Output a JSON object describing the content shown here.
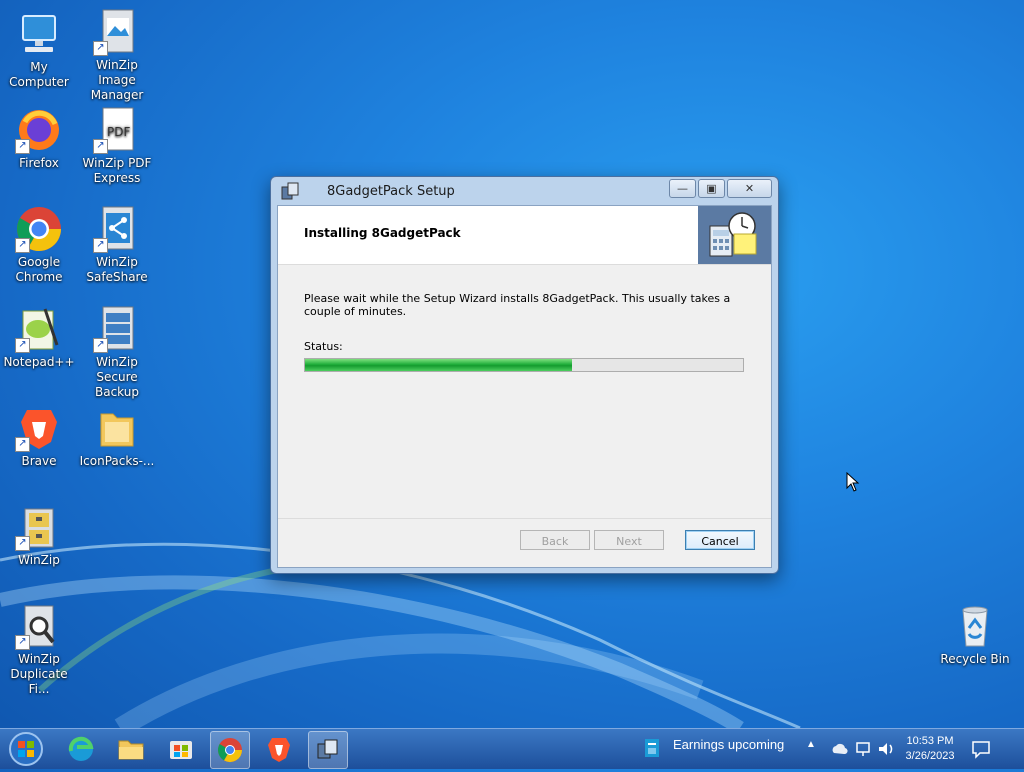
{
  "desktop": {
    "icons_left": [
      {
        "label": "My Computer",
        "icon": "computer-icon"
      },
      {
        "label": "Firefox",
        "icon": "firefox-icon"
      },
      {
        "label": "Google Chrome",
        "icon": "chrome-icon"
      },
      {
        "label": "Notepad++",
        "icon": "notepadpp-icon"
      },
      {
        "label": "Brave",
        "icon": "brave-icon"
      },
      {
        "label": "WinZip",
        "icon": "winzip-icon"
      },
      {
        "label": "WinZip Duplicate Fi...",
        "icon": "winzip-duplicate-icon"
      }
    ],
    "icons_right_col": [
      {
        "label": "WinZip Image Manager",
        "icon": "winzip-image-icon"
      },
      {
        "label": "WinZip PDF Express",
        "icon": "winzip-pdf-icon"
      },
      {
        "label": "WinZip SafeShare",
        "icon": "winzip-safeshare-icon"
      },
      {
        "label": "WinZip Secure Backup",
        "icon": "winzip-backup-icon"
      },
      {
        "label": "IconPacks-...",
        "icon": "folder-icon"
      }
    ],
    "recycle_bin": {
      "label": "Recycle Bin",
      "icon": "recycle-bin-icon"
    }
  },
  "window": {
    "title": "8GadgetPack Setup",
    "heading": "Installing 8GadgetPack",
    "description": "Please wait while the Setup Wizard installs 8GadgetPack. This usually takes a couple of minutes.",
    "status_label": "Status:",
    "progress_fraction": 0.61,
    "buttons": {
      "back": "Back",
      "next": "Next",
      "cancel": "Cancel"
    },
    "controls": {
      "minimize": "minimize-icon",
      "maximize": "maximize-icon",
      "close": "close-icon"
    }
  },
  "taskbar": {
    "pinned": [
      "start-orb-icon",
      "edge-icon",
      "file-explorer-icon",
      "store-icon",
      "chrome-icon",
      "brave-icon",
      "setup-icon"
    ],
    "news": "Earnings upcoming",
    "time": "10:53 PM",
    "date": "3/26/2023"
  },
  "colors": {
    "desktop": "#1f83df",
    "progress": "#1fae3b",
    "taskbar": "#2a63b3"
  }
}
